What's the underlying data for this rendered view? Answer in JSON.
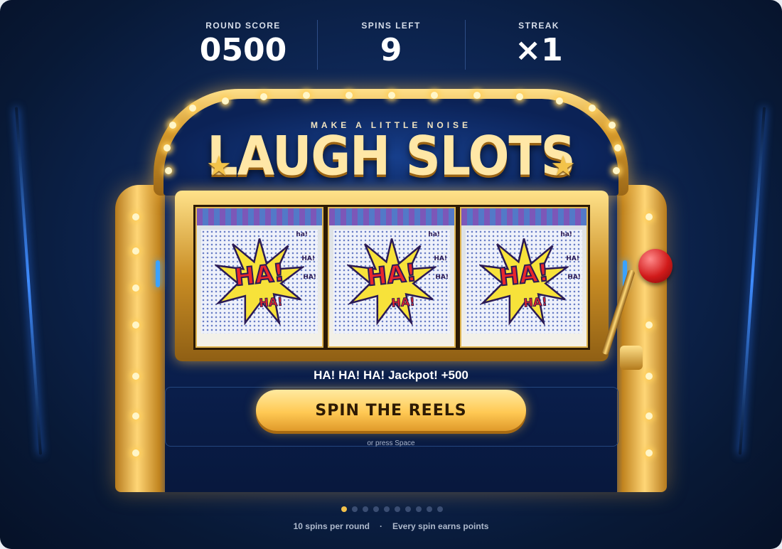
{
  "stats": [
    {
      "label": "ROUND SCORE",
      "value": "0500"
    },
    {
      "label": "SPINS LEFT",
      "value": "9"
    },
    {
      "label": "STREAK",
      "value": "×1"
    }
  ],
  "marquee": {
    "tagline": "MAKE A LITTLE NOISE",
    "title": "LAUGH SLOTS"
  },
  "reels": [
    {
      "symbol": "HA!",
      "sub": "HA!",
      "small_text": [
        "ha!",
        "HA!",
        "HA!"
      ]
    },
    {
      "symbol": "HA!",
      "sub": "HA!",
      "small_text": [
        "ha!",
        "HA!",
        "HA!"
      ]
    },
    {
      "symbol": "HA!",
      "sub": "HA!",
      "small_text": [
        "ha!",
        "HA!",
        "HA!"
      ]
    }
  ],
  "result_message": "HA! HA! HA! Jackpot! +500",
  "spin_button": {
    "label": "SPIN THE REELS",
    "hint": "or press Space"
  },
  "progress": {
    "total_spins": 10,
    "current": 1
  },
  "footer": {
    "left": "10 spins per round",
    "separator": "·",
    "right": "Every spin earns points"
  },
  "colors": {
    "accent_gold": "#f2c14b",
    "background": "#0d2552",
    "lever_knob": "#d11a1a"
  }
}
